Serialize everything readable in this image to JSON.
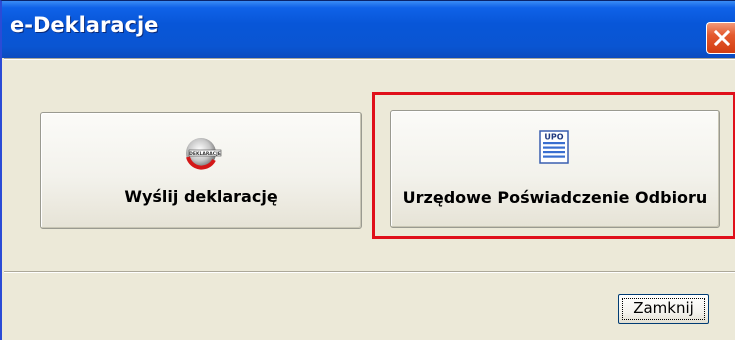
{
  "window": {
    "title": "e-Deklaracje",
    "close_icon": "close-icon"
  },
  "buttons": {
    "send": {
      "label": "Wyślij deklarację",
      "icon": "e-deklaracje-logo-icon",
      "icon_text": "DEKLARACJE"
    },
    "upo": {
      "label": "Urzędowe Poświadczenie Odbioru",
      "icon": "upo-document-icon",
      "icon_text": "UPO"
    }
  },
  "footer": {
    "close_label": "Zamknij"
  },
  "colors": {
    "titlebar": "#0a55d2",
    "highlight": "#e0101a",
    "window_bg": "#ece9d8"
  }
}
